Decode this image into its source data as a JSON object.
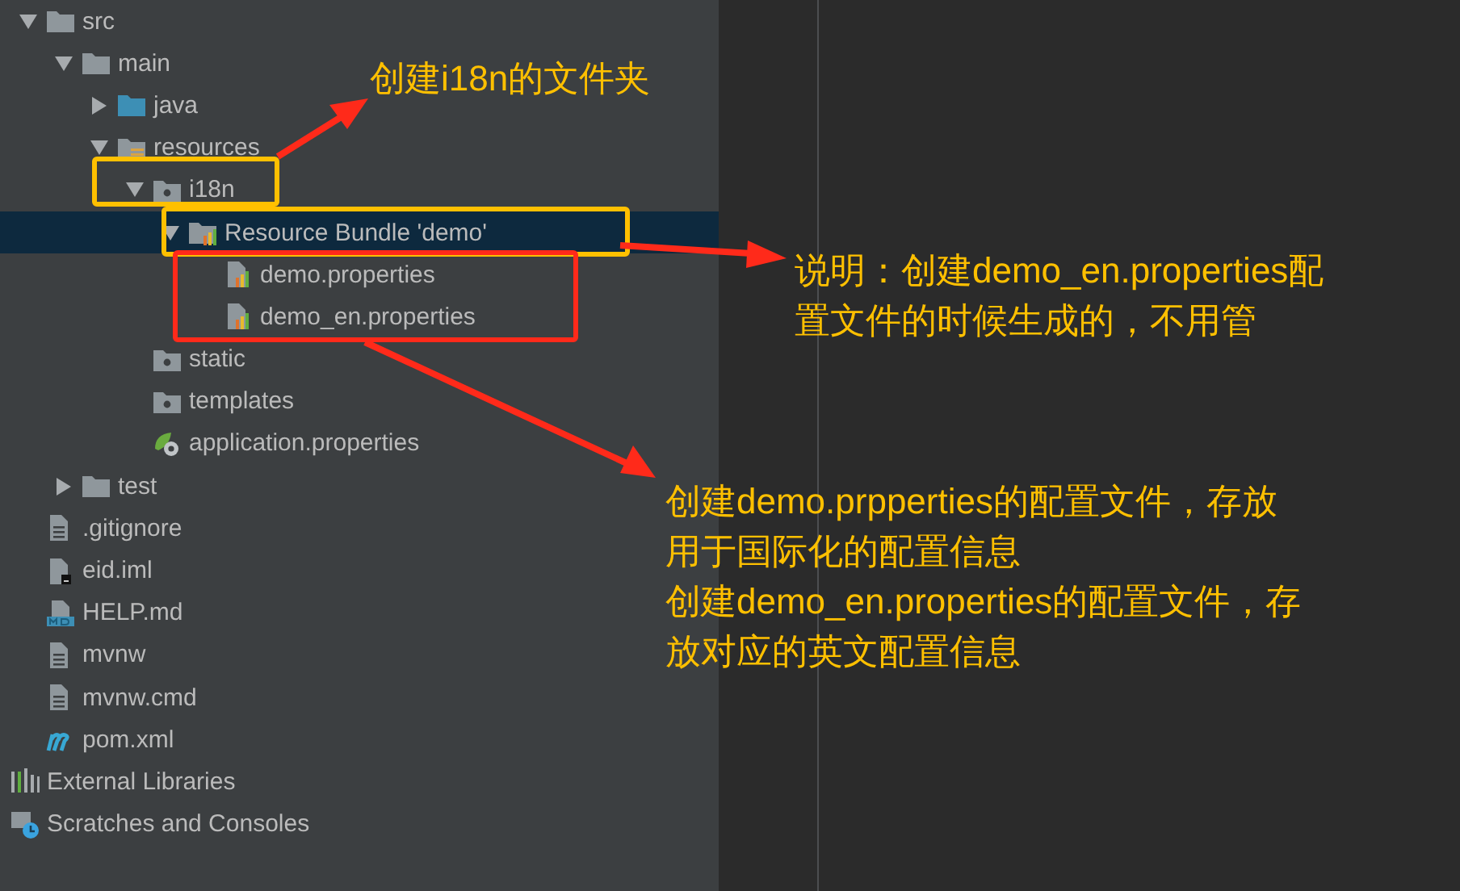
{
  "tree": [
    {
      "label": "src",
      "kind": "folder",
      "expanded": true,
      "selected": false,
      "children": [
        {
          "label": "main",
          "kind": "folder",
          "expanded": true,
          "selected": false,
          "children": [
            {
              "label": "java",
              "kind": "source-folder",
              "expanded": false,
              "selected": false
            },
            {
              "label": "resources",
              "kind": "resource-folder",
              "expanded": true,
              "selected": false,
              "children": [
                {
                  "label": "i18n",
                  "kind": "package",
                  "expanded": true,
                  "selected": false,
                  "children": [
                    {
                      "label": "Resource Bundle 'demo'",
                      "kind": "bundle",
                      "expanded": true,
                      "selected": true,
                      "children": [
                        {
                          "label": "demo.properties",
                          "kind": "properties-file",
                          "selected": false
                        },
                        {
                          "label": "demo_en.properties",
                          "kind": "properties-file",
                          "selected": false
                        }
                      ]
                    }
                  ]
                },
                {
                  "label": "static",
                  "kind": "package",
                  "selected": false
                },
                {
                  "label": "templates",
                  "kind": "package",
                  "selected": false
                },
                {
                  "label": "application.properties",
                  "kind": "spring-file",
                  "selected": false
                }
              ]
            }
          ]
        },
        {
          "label": "test",
          "kind": "folder",
          "expanded": false,
          "selected": false
        }
      ]
    },
    {
      "label": ".gitignore",
      "kind": "text-file",
      "selected": false
    },
    {
      "label": "eid.iml",
      "kind": "module-file",
      "selected": false
    },
    {
      "label": "HELP.md",
      "kind": "markdown-file",
      "selected": false
    },
    {
      "label": "mvnw",
      "kind": "text-file",
      "selected": false
    },
    {
      "label": "mvnw.cmd",
      "kind": "text-file",
      "selected": false
    },
    {
      "label": "pom.xml",
      "kind": "maven-file",
      "selected": false
    }
  ],
  "extra_items": [
    {
      "label": "External Libraries",
      "kind": "libraries",
      "selected": false
    },
    {
      "label": "Scratches and Consoles",
      "kind": "scratches",
      "selected": false
    }
  ],
  "callouts": [
    "创建i18n的文件夹",
    "说明：创建demo_en.properties配置文件的时候生成的，不用管",
    "创建demo.prpperties的配置文件，存放用于国际化的配置信息",
    "创建demo_en.properties的配置文件，存放对应的英文配置信息"
  ]
}
